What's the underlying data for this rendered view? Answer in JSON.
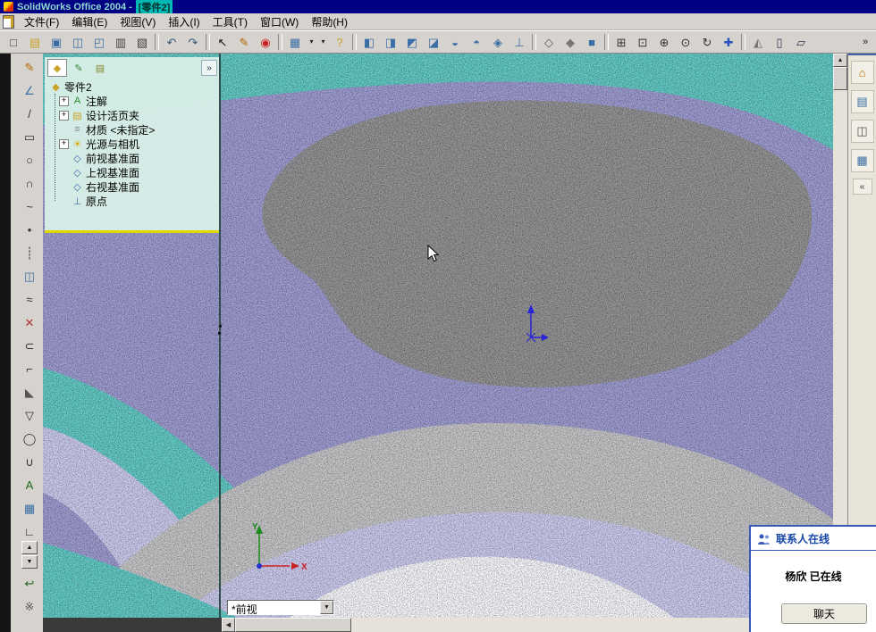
{
  "window": {
    "title_app": "SolidWorks Office 2004 -",
    "title_doc": "[零件2]"
  },
  "menu_bar": {
    "items": [
      {
        "name": "menu-file",
        "label": "文件(F)"
      },
      {
        "name": "menu-edit",
        "label": "编辑(E)"
      },
      {
        "name": "menu-view",
        "label": "视图(V)"
      },
      {
        "name": "menu-insert",
        "label": "插入(I)"
      },
      {
        "name": "menu-tools",
        "label": "工具(T)"
      },
      {
        "name": "menu-window",
        "label": "窗口(W)"
      },
      {
        "name": "menu-help",
        "label": "帮助(H)"
      }
    ]
  },
  "main_toolbar": {
    "overflow": "»",
    "items": [
      {
        "name": "new-button",
        "glyph": "□",
        "color": "#333355"
      },
      {
        "name": "open-button",
        "glyph": "▤",
        "color": "#c9a227"
      },
      {
        "name": "save-button",
        "glyph": "▣",
        "color": "#3a6ea5"
      },
      {
        "name": "make-drawing-button",
        "glyph": "◫",
        "color": "#3a6ea5"
      },
      {
        "name": "make-assembly-button",
        "glyph": "◰",
        "color": "#3a6ea5"
      },
      {
        "name": "print-button",
        "glyph": "▥",
        "color": "#444444"
      },
      {
        "name": "print-preview-button",
        "glyph": "▧",
        "color": "#444444"
      },
      {
        "name": "separator",
        "sep": "1",
        "inter": "false",
        "glyph": ""
      },
      {
        "name": "undo-button",
        "glyph": "↶",
        "color": "#335577"
      },
      {
        "name": "redo-button",
        "glyph": "↷",
        "color": "#335577"
      },
      {
        "name": "separator",
        "sep": "1",
        "inter": "false",
        "glyph": ""
      },
      {
        "name": "select-tool-button",
        "glyph": "↖",
        "color": "#111111"
      },
      {
        "name": "sketch-button",
        "glyph": "✎",
        "color": "#b06a00"
      },
      {
        "name": "rebuild-button",
        "glyph": "◉",
        "color": "#cc2222"
      },
      {
        "name": "separator",
        "sep": "1",
        "inter": "false",
        "glyph": ""
      },
      {
        "name": "grid-button",
        "glyph": "▦",
        "color": "#3a6ea5"
      },
      {
        "name": "grid-dropdown",
        "glyph": "▾",
        "color": "#222222",
        "small": "1"
      },
      {
        "name": "view-settings-dropdown",
        "glyph": "▾",
        "color": "#222222",
        "small": "1"
      },
      {
        "name": "help-button",
        "glyph": "?",
        "color": "#c9a227"
      },
      {
        "name": "separator",
        "sep": "1",
        "inter": "false",
        "glyph": ""
      },
      {
        "name": "front-view-button",
        "glyph": "◧",
        "color": "#3a6ea5"
      },
      {
        "name": "back-view-button",
        "glyph": "◨",
        "color": "#3a6ea5"
      },
      {
        "name": "left-view-button",
        "glyph": "◩",
        "color": "#3a6ea5"
      },
      {
        "name": "right-view-button",
        "glyph": "◪",
        "color": "#3a6ea5"
      },
      {
        "name": "top-view-button",
        "glyph": "◒",
        "color": "#3a6ea5"
      },
      {
        "name": "bottom-view-button",
        "glyph": "◓",
        "color": "#3a6ea5"
      },
      {
        "name": "isometric-view-button",
        "glyph": "◈",
        "color": "#3a6ea5"
      },
      {
        "name": "normal-to-button",
        "glyph": "⊥",
        "color": "#3a6ea5"
      },
      {
        "name": "separator",
        "sep": "1",
        "inter": "false",
        "glyph": ""
      },
      {
        "name": "wireframe-button",
        "glyph": "◇",
        "color": "#555555"
      },
      {
        "name": "hidden-lines-button",
        "glyph": "◆",
        "color": "#777777"
      },
      {
        "name": "shaded-button",
        "glyph": "■",
        "color": "#3a6ea5"
      },
      {
        "name": "separator",
        "sep": "1",
        "inter": "false",
        "glyph": ""
      },
      {
        "name": "zoom-fit-button",
        "glyph": "⊞",
        "color": "#333333"
      },
      {
        "name": "zoom-area-button",
        "glyph": "⊡",
        "color": "#333333"
      },
      {
        "name": "zoom-in-out-button",
        "glyph": "⊕",
        "color": "#333333"
      },
      {
        "name": "zoom-selection-button",
        "glyph": "⊙",
        "color": "#333333"
      },
      {
        "name": "rotate-view-button",
        "glyph": "↻",
        "color": "#333333"
      },
      {
        "name": "pan-button",
        "glyph": "✚",
        "color": "#2a52be"
      },
      {
        "name": "separator",
        "sep": "1",
        "inter": "false",
        "glyph": ""
      },
      {
        "name": "section-view-button",
        "glyph": "◭",
        "color": "#777777"
      },
      {
        "name": "window-tile-button",
        "glyph": "▯",
        "color": "#333355"
      },
      {
        "name": "window-cascade-button",
        "glyph": "▱",
        "color": "#333355"
      }
    ]
  },
  "left_toolbar": {
    "scroll_up": "▲",
    "scroll_down": "▼",
    "items": [
      {
        "name": "sketch-tool",
        "glyph": "✎",
        "color": "#b06a00"
      },
      {
        "name": "dimension-tool",
        "glyph": "∠",
        "color": "#3a6ea5"
      },
      {
        "name": "line-tool",
        "glyph": "/",
        "color": "#333333"
      },
      {
        "name": "rectangle-tool",
        "glyph": "▭",
        "color": "#333333"
      },
      {
        "name": "circle-tool",
        "glyph": "○",
        "color": "#333333"
      },
      {
        "name": "arc-tool",
        "glyph": "∩",
        "color": "#333333"
      },
      {
        "name": "spline-tool",
        "glyph": "~",
        "color": "#333333"
      },
      {
        "name": "point-tool",
        "glyph": "•",
        "color": "#333333"
      },
      {
        "name": "centerline-tool",
        "glyph": "┊",
        "color": "#333333"
      },
      {
        "name": "mirror-tool",
        "glyph": "◫",
        "color": "#3a6ea5"
      },
      {
        "name": "offset-tool",
        "glyph": "≈",
        "color": "#333333"
      },
      {
        "name": "trim-tool",
        "glyph": "✕",
        "color": "#aa3333"
      },
      {
        "name": "convert-entities-tool",
        "glyph": "⊂",
        "color": "#333333"
      },
      {
        "name": "fillet-tool",
        "glyph": "⌐",
        "color": "#333333"
      },
      {
        "name": "chamfer-tool",
        "glyph": "◣",
        "color": "#555555"
      },
      {
        "name": "polygon-tool",
        "glyph": "▽",
        "color": "#333333"
      },
      {
        "name": "ellipse-tool",
        "glyph": "◯",
        "color": "#333333"
      },
      {
        "name": "parabola-tool",
        "glyph": "∪",
        "color": "#333333"
      },
      {
        "name": "text-tool",
        "glyph": "A",
        "color": "#226622"
      },
      {
        "name": "grid-snap-tool",
        "glyph": "▦",
        "color": "#3a6ea5"
      },
      {
        "name": "measure-tool",
        "glyph": "∟",
        "color": "#333333"
      }
    ],
    "bottom_items": [
      {
        "name": "exit-sketch-tool",
        "glyph": "↩",
        "color": "#226622"
      },
      {
        "name": "tool-options",
        "glyph": "※",
        "color": "#555555"
      }
    ]
  },
  "feature_tree": {
    "expand_button": "»",
    "tabs": [
      {
        "name": "tab-featuremanager",
        "glyph": "◆",
        "color": "#c9a227",
        "active": "1"
      },
      {
        "name": "tab-propertymanager",
        "glyph": "✎",
        "color": "#3a8a3a"
      },
      {
        "name": "tab-configurationmanager",
        "glyph": "▤",
        "color": "#888833"
      }
    ],
    "root": {
      "label": "零件2",
      "glyph": "◆",
      "color": "#c9a227"
    },
    "items": [
      {
        "name": "tree-item-annotations",
        "label": "注解",
        "glyph": "A",
        "color": "#2a8a2a",
        "expand": "+"
      },
      {
        "name": "tree-item-design-binder",
        "label": "设计活页夹",
        "glyph": "▤",
        "color": "#c9a227",
        "expand": "+"
      },
      {
        "name": "tree-item-material",
        "label": "材质 <未指定>",
        "glyph": "≡",
        "color": "#888888",
        "expand": ""
      },
      {
        "name": "tree-item-lights-cameras",
        "label": "光源与相机",
        "glyph": "☀",
        "color": "#d8a800",
        "expand": "+"
      },
      {
        "name": "tree-item-front-plane",
        "label": "前视基准面",
        "glyph": "◇",
        "color": "#3a6ea5",
        "expand": ""
      },
      {
        "name": "tree-item-top-plane",
        "label": "上视基准面",
        "glyph": "◇",
        "color": "#3a6ea5",
        "expand": ""
      },
      {
        "name": "tree-item-right-plane",
        "label": "右视基准面",
        "glyph": "◇",
        "color": "#3a6ea5",
        "expand": ""
      },
      {
        "name": "tree-item-origin",
        "label": "原点",
        "glyph": "⊥",
        "color": "#3a6ea5",
        "expand": ""
      }
    ]
  },
  "viewport": {
    "view_selector": {
      "value": "*前视",
      "dropdown_glyph": "▼"
    },
    "triad": {
      "x_label": "X",
      "y_label": "Y"
    },
    "colors": {
      "base": "#9795cf",
      "teal": "#57c8c3",
      "gray_blob": "#8b8b8d",
      "light_gray": "#c3c3c6",
      "lavender": "#c9c9ef",
      "white": "#fafaff"
    }
  },
  "task_pane": {
    "collapse": "«",
    "items": [
      {
        "name": "solidworks-resources-button",
        "glyph": "⌂",
        "color": "#b06a00"
      },
      {
        "name": "design-library-button",
        "glyph": "▤",
        "color": "#3a6ea5"
      },
      {
        "name": "file-explorer-button",
        "glyph": "◫",
        "color": "#555555"
      },
      {
        "name": "view-palette-button",
        "glyph": "▦",
        "color": "#3a6ea5"
      }
    ]
  },
  "contacts_panel": {
    "title": "联系人在线",
    "status": "杨欣 已在线",
    "chat_button": "聊天"
  },
  "scrollbars": {
    "up": "▲",
    "down": "▼",
    "left": "◀",
    "right": "▶"
  },
  "splitter_arrows": {
    "left": "◄",
    "right": "►"
  }
}
